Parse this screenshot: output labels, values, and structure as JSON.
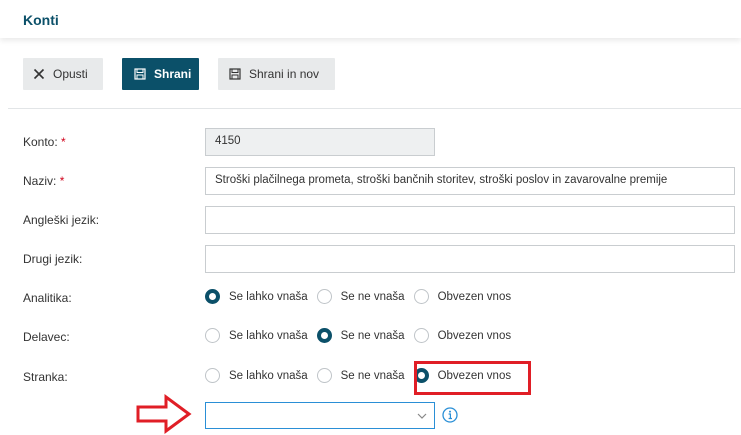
{
  "header": {
    "title": "Konti"
  },
  "toolbar": {
    "cancel_label": "Opusti",
    "save_label": "Shrani",
    "save_new_label": "Shrani in nov"
  },
  "form": {
    "konto": {
      "label": "Konto:",
      "required_mark": "*",
      "value": "4150"
    },
    "naziv": {
      "label": "Naziv:",
      "required_mark": "*",
      "value": "Stroški plačilnega prometa, stroški bančnih storitev, stroški poslov in zavarovalne premije"
    },
    "angleski": {
      "label": "Angleški jezik:",
      "value": ""
    },
    "drugi": {
      "label": "Drugi jezik:",
      "value": ""
    },
    "analitika": {
      "label": "Analitika:",
      "selected": 0
    },
    "delavec": {
      "label": "Delavec:",
      "selected": 1
    },
    "stranka": {
      "label": "Stranka:",
      "selected": 2
    },
    "radio_options": [
      "Se lahko vnaša",
      "Se ne vnaša",
      "Obvezen vnos"
    ],
    "stranka_select": {
      "value": ""
    }
  },
  "colors": {
    "primary": "#0b5069",
    "highlight": "#e01e26",
    "focus": "#2a8fd6"
  },
  "icons": [
    "close-icon",
    "save-icon",
    "save-new-icon",
    "chevron-down-icon",
    "info-icon",
    "arrow-right-icon"
  ]
}
